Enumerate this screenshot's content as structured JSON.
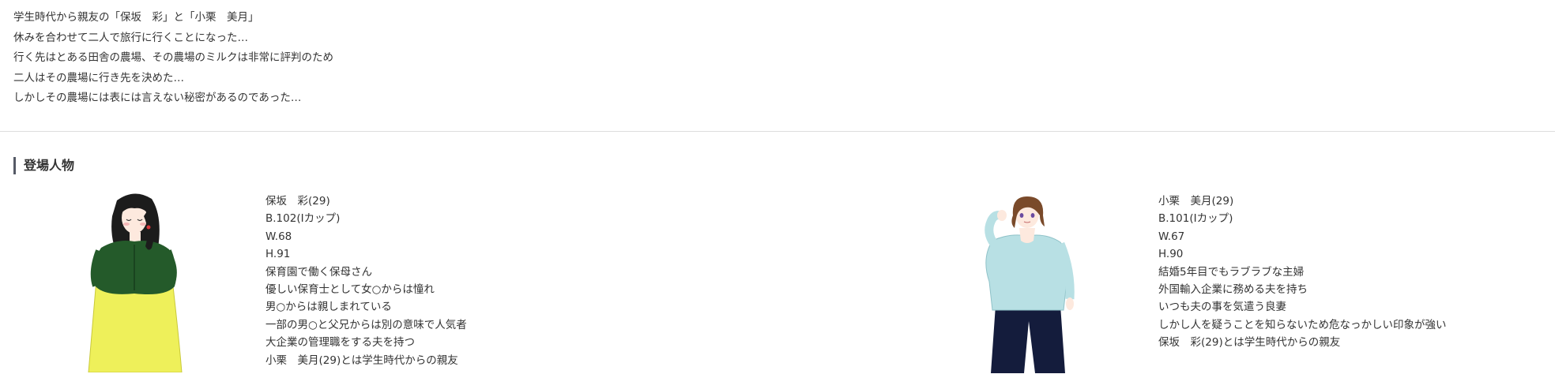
{
  "synopsis": [
    "学生時代から親友の「保坂　彩」と「小栗　美月」",
    "休みを合わせて二人で旅行に行くことになった…",
    "行く先はとある田舎の農場、その農場のミルクは非常に評判のため",
    "二人はその農場に行き先を決めた…",
    "しかしその農場には表には言えない秘密があるのであった…"
  ],
  "characters_section": {
    "heading": "登場人物",
    "characters": [
      {
        "lines": [
          "保坂　彩(29)",
          "B.102(Iカップ)",
          "W.68",
          "H.91",
          "保育園で働く保母さん",
          "優しい保育士として女○からは憧れ",
          "男○からは親しまれている",
          "一部の男○と父兄からは別の意味で人気者",
          "大企業の管理職をする夫を持つ",
          "小栗　美月(29)とは学生時代からの親友"
        ],
        "colors": {
          "hair": "#1c1c1c",
          "top": "#245a2a",
          "skirt": "#eef05a",
          "skin": "#fde9de"
        }
      },
      {
        "lines": [
          "小栗　美月(29)",
          "B.101(Iカップ)",
          "W.67",
          "H.90",
          "結婚5年目でもラブラブな主婦",
          "外国輸入企業に務める夫を持ち",
          "いつも夫の事を気遣う良妻",
          "しかし人を疑うことを知らないため危なっかしい印象が強い",
          "保坂　彩(29)とは学生時代からの親友"
        ],
        "colors": {
          "hair": "#7a4a2a",
          "top": "#b8e0e4",
          "pants": "#141c3c",
          "skin": "#fde9de"
        }
      }
    ]
  },
  "colors": {
    "heading_bar": "#555a66",
    "divider": "#dddddd",
    "text": "#333333"
  }
}
